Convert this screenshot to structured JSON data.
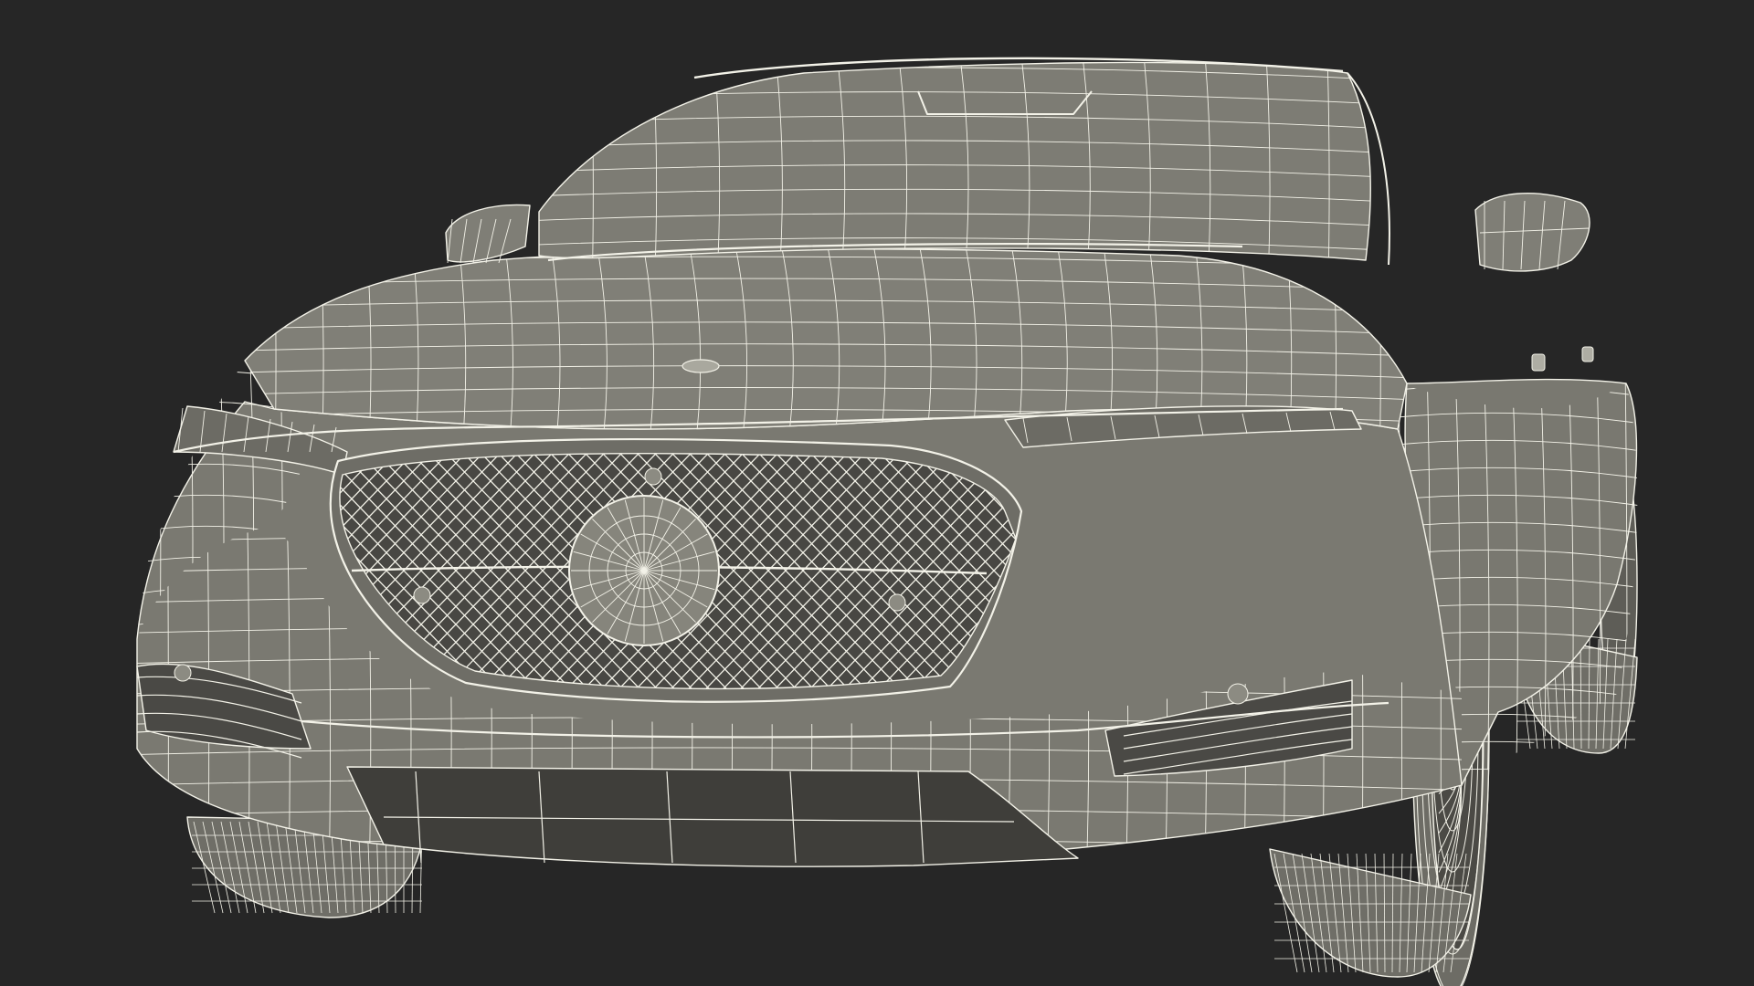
{
  "scene": {
    "subject": "sedan-wireframe-front-three-quarter",
    "background_color": "#262626",
    "mesh_fill": "#7b7a72",
    "mesh_fill_dark": "#4f4e49",
    "mesh_fill_shadow": "#3a3a37",
    "wire_color": "#f3f2e8",
    "grille_cells": 150,
    "wheel_spokes": 10
  }
}
